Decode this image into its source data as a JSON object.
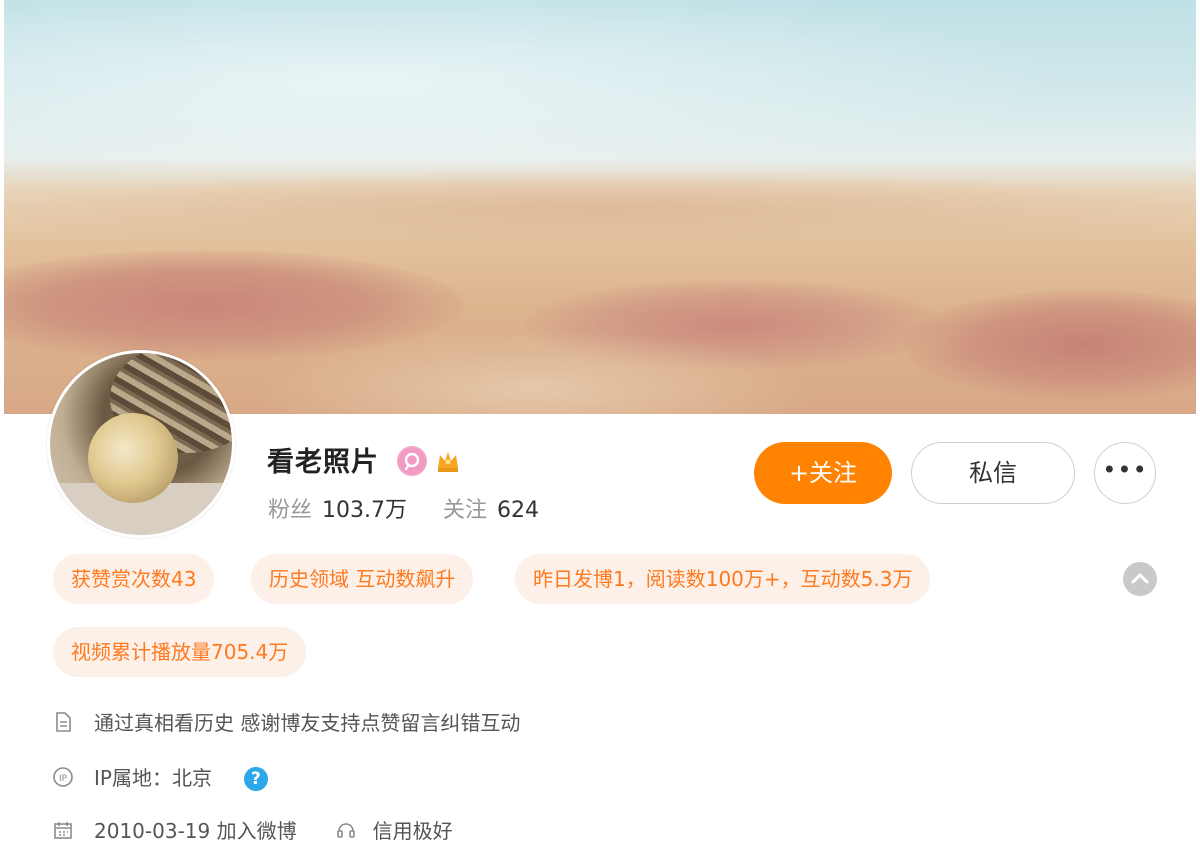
{
  "profile": {
    "name": "看老照片",
    "followers_label": "粉丝",
    "followers_value": "103.7万",
    "following_label": "关注",
    "following_value": "624"
  },
  "actions": {
    "follow_label": "+关注",
    "message_label": "私信",
    "more_label": "•••"
  },
  "tags": [
    "获赞赏次数43",
    "历史领域 互动数飙升",
    "昨日发博1，阅读数100万+，互动数5.3万",
    "视频累计播放量705.4万"
  ],
  "info": {
    "bio": "通过真相看历史 感谢博友支持点赞留言纠错互动",
    "ip": "IP属地：北京",
    "joined": "2010-03-19 加入微博",
    "credit": "信用极好"
  },
  "colors": {
    "accent": "#ff8200",
    "tag_bg": "#fdf0e8",
    "tag_text": "#ff7a1f",
    "help": "#2ea7ea"
  }
}
